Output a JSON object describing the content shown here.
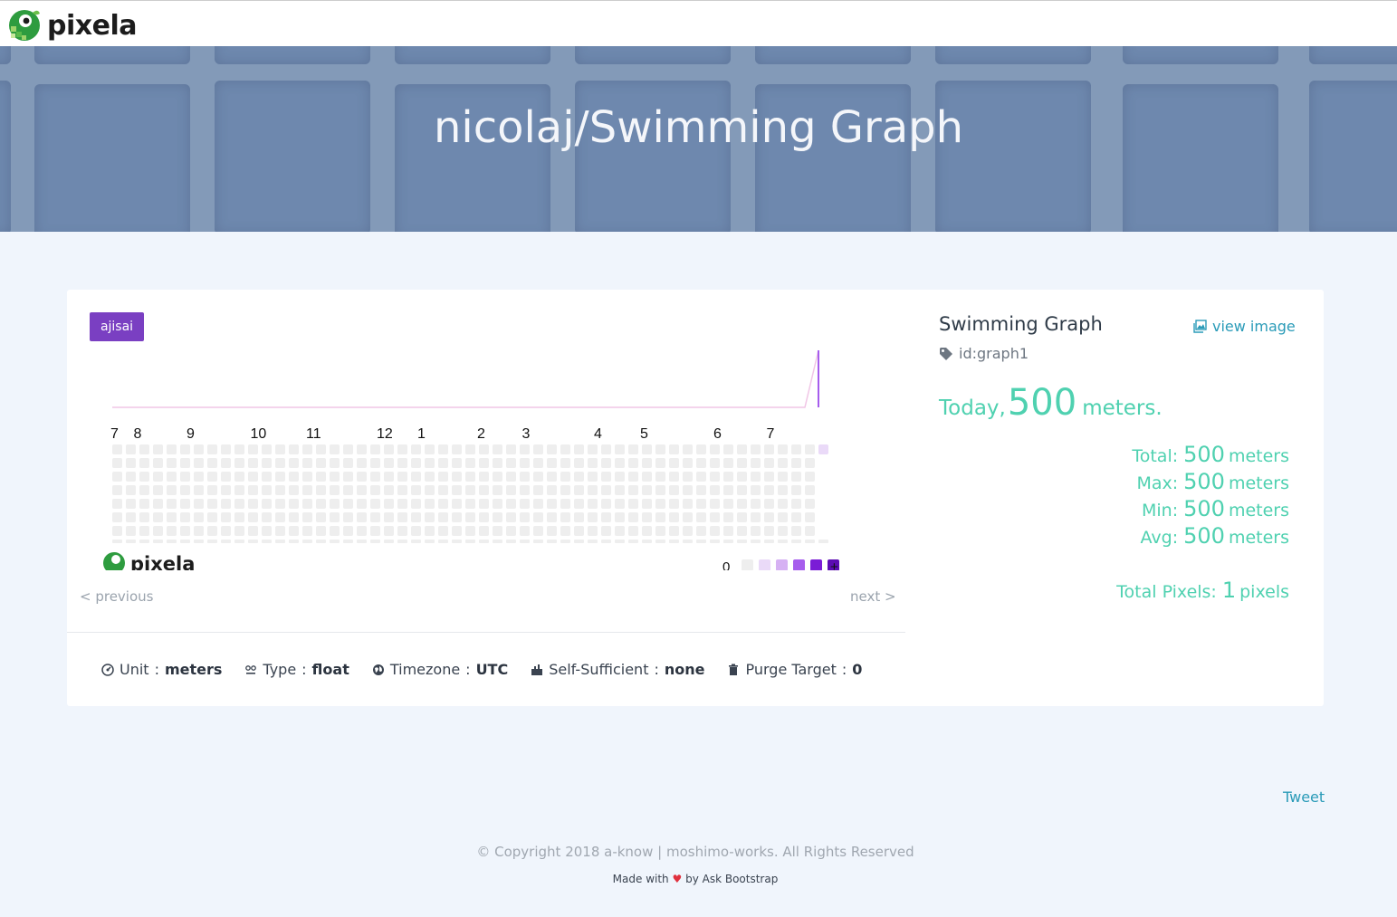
{
  "navbar": {
    "brand": "pixela"
  },
  "hero": {
    "title": "nicolaj/Swimming Graph"
  },
  "graph": {
    "theme_badge": "ajisai",
    "months": [
      "7",
      "8",
      "9",
      "10",
      "11",
      "12",
      "1",
      "2",
      "3",
      "4",
      "5",
      "6",
      "7"
    ],
    "legend": {
      "low": "0",
      "high": "+",
      "colors": [
        "#eeeeee",
        "#eadaf8",
        "#d6b1f3",
        "#a65ded",
        "#7a1cd6",
        "#5c0cb3"
      ]
    },
    "logo": "pixela",
    "pixels": [
      {
        "week": 52,
        "day": 0,
        "level": 1
      }
    ],
    "chart_data": {
      "type": "line",
      "series": [
        {
          "values": [
            0,
            0,
            0,
            0,
            0,
            0,
            0,
            0,
            0,
            0,
            0,
            0,
            0,
            0,
            0,
            0,
            0,
            0,
            0,
            0,
            0,
            0,
            0,
            0,
            0,
            0,
            0,
            0,
            0,
            0,
            0,
            0,
            0,
            0,
            0,
            0,
            0,
            0,
            0,
            0,
            0,
            0,
            0,
            0,
            0,
            0,
            0,
            0,
            0,
            0,
            0,
            0,
            500
          ]
        }
      ]
    },
    "pager": {
      "previous": "< previous",
      "next": "next >"
    }
  },
  "meta": {
    "unit_label": "Unit",
    "unit_value": "meters",
    "type_label": "Type",
    "type_value": "float",
    "timezone_label": "Timezone",
    "timezone_value": "UTC",
    "self_label": "Self-Sufficient",
    "self_value": "none",
    "purge_label": "Purge Target",
    "purge_value": "0",
    "sep": ":"
  },
  "info": {
    "title": "Swimming Graph",
    "view_image": "view image",
    "graph_id": "id:graph1",
    "today_label": "Today,",
    "today_value": "500",
    "today_unit": "meters.",
    "stats": [
      {
        "label": "Total:",
        "value": "500",
        "unit": "meters"
      },
      {
        "label": "Max:",
        "value": "500",
        "unit": "meters"
      },
      {
        "label": "Min:",
        "value": "500",
        "unit": "meters"
      },
      {
        "label": "Avg:",
        "value": "500",
        "unit": "meters"
      }
    ],
    "total_pixels": {
      "label": "Total Pixels:",
      "value": "1",
      "unit": "pixels"
    }
  },
  "footer": {
    "tweet": "Tweet",
    "copyright": "© Copyright 2018 a-know | moshimo-works. All Rights Reserved",
    "made_prefix": "Made with",
    "heart": "♥",
    "made_suffix": "by Ask Bootstrap"
  }
}
